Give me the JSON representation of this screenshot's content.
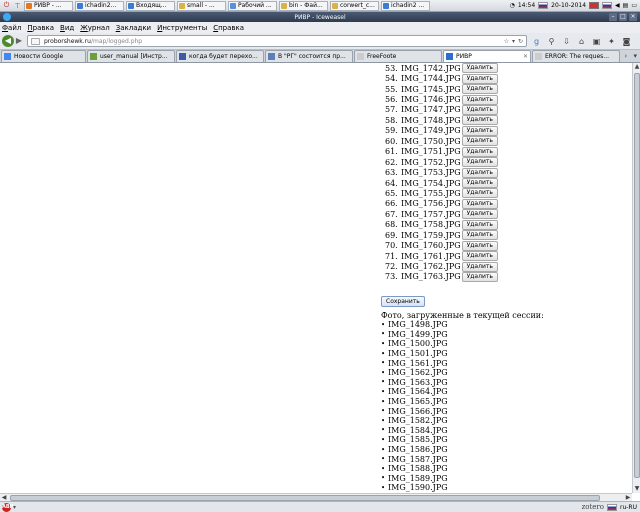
{
  "taskbar": {
    "tasks": [
      {
        "label": "РИВР - ...",
        "color": "#e37a22",
        "active": false
      },
      {
        "label": "ichadin2...",
        "color": "#3a7bd5",
        "active": false
      },
      {
        "label": "Входящ...",
        "color": "#3a7bd5",
        "active": false
      },
      {
        "label": "small - ...",
        "color": "#d8b24a",
        "active": false
      },
      {
        "label": "Рабочий ...",
        "color": "#5a8ed8",
        "active": false
      },
      {
        "label": "bin - Фай...",
        "color": "#d8b24a",
        "active": false
      },
      {
        "label": "corwert_c...",
        "color": "#d8b24a",
        "active": false
      },
      {
        "label": "ichadin2 ...",
        "color": "#3a7bd5",
        "active": false
      }
    ],
    "time": "14:54",
    "date": "20-10-2014"
  },
  "window": {
    "title": "РИВР - Iceweasel"
  },
  "menubar": {
    "items": [
      {
        "accel": "Ф",
        "rest": "айл"
      },
      {
        "accel": "П",
        "rest": "равка"
      },
      {
        "accel": "В",
        "rest": "ид"
      },
      {
        "accel": "Ж",
        "rest": "урнал"
      },
      {
        "accel": "З",
        "rest": "акладки"
      },
      {
        "accel": "И",
        "rest": "нструменты"
      },
      {
        "accel": "С",
        "rest": "правка"
      }
    ]
  },
  "navbar": {
    "url_host": "proborshewk.ru",
    "url_path": "/map/logged.php"
  },
  "tabs": [
    {
      "label": "Новости Google",
      "icon_color": "#4285f4",
      "active": false,
      "width": 85
    },
    {
      "label": "user_manual [Инстр...",
      "icon_color": "#6a9f3a",
      "active": false,
      "width": 88
    },
    {
      "label": "когда будет перехо...",
      "icon_color": "#3b5ba8",
      "active": false,
      "width": 88
    },
    {
      "label": "В \"РГ\" состоится пр...",
      "icon_color": "#5b7fb8",
      "active": false,
      "width": 88
    },
    {
      "label": "FreeFoote",
      "icon_color": "#cccccc",
      "active": false,
      "width": 88
    },
    {
      "label": "РИВР",
      "icon_color": "#2a6fcf",
      "active": true,
      "width": 88
    },
    {
      "label": "ERROR: The reques...",
      "icon_color": "#cccccc",
      "active": false,
      "width": 88
    }
  ],
  "photos": {
    "delete_label": "Удалить",
    "items": [
      {
        "num": "53.",
        "name": "IMG_1742.JPG"
      },
      {
        "num": "54.",
        "name": "IMG_1744.JPG"
      },
      {
        "num": "55.",
        "name": "IMG_1745.JPG"
      },
      {
        "num": "56.",
        "name": "IMG_1746.JPG"
      },
      {
        "num": "57.",
        "name": "IMG_1747.JPG"
      },
      {
        "num": "58.",
        "name": "IMG_1748.JPG"
      },
      {
        "num": "59.",
        "name": "IMG_1749.JPG"
      },
      {
        "num": "60.",
        "name": "IMG_1750.JPG"
      },
      {
        "num": "61.",
        "name": "IMG_1751.JPG"
      },
      {
        "num": "62.",
        "name": "IMG_1752.JPG"
      },
      {
        "num": "63.",
        "name": "IMG_1753.JPG"
      },
      {
        "num": "64.",
        "name": "IMG_1754.JPG"
      },
      {
        "num": "65.",
        "name": "IMG_1755.JPG"
      },
      {
        "num": "66.",
        "name": "IMG_1756.JPG"
      },
      {
        "num": "67.",
        "name": "IMG_1757.JPG"
      },
      {
        "num": "68.",
        "name": "IMG_1758.JPG"
      },
      {
        "num": "69.",
        "name": "IMG_1759.JPG"
      },
      {
        "num": "70.",
        "name": "IMG_1760.JPG"
      },
      {
        "num": "71.",
        "name": "IMG_1761.JPG"
      },
      {
        "num": "72.",
        "name": "IMG_1762.JPG"
      },
      {
        "num": "73.",
        "name": "IMG_1763.JPG"
      }
    ]
  },
  "save_label": "Сохранить",
  "session": {
    "heading": "Фото, загруженные в текущей сессии:",
    "items": [
      "IMG_1498.JPG",
      "IMG_1499.JPG",
      "IMG_1500.JPG",
      "IMG_1501.JPG",
      "IMG_1561.JPG",
      "IMG_1562.JPG",
      "IMG_1563.JPG",
      "IMG_1564.JPG",
      "IMG_1565.JPG",
      "IMG_1566.JPG",
      "IMG_1582.JPG",
      "IMG_1584.JPG",
      "IMG_1585.JPG",
      "IMG_1586.JPG",
      "IMG_1587.JPG",
      "IMG_1588.JPG",
      "IMG_1589.JPG",
      "IMG_1590.JPG"
    ]
  },
  "statusbar": {
    "abp_label": "ABP",
    "zotero_label": "zotero",
    "locale": "ru-RU"
  }
}
